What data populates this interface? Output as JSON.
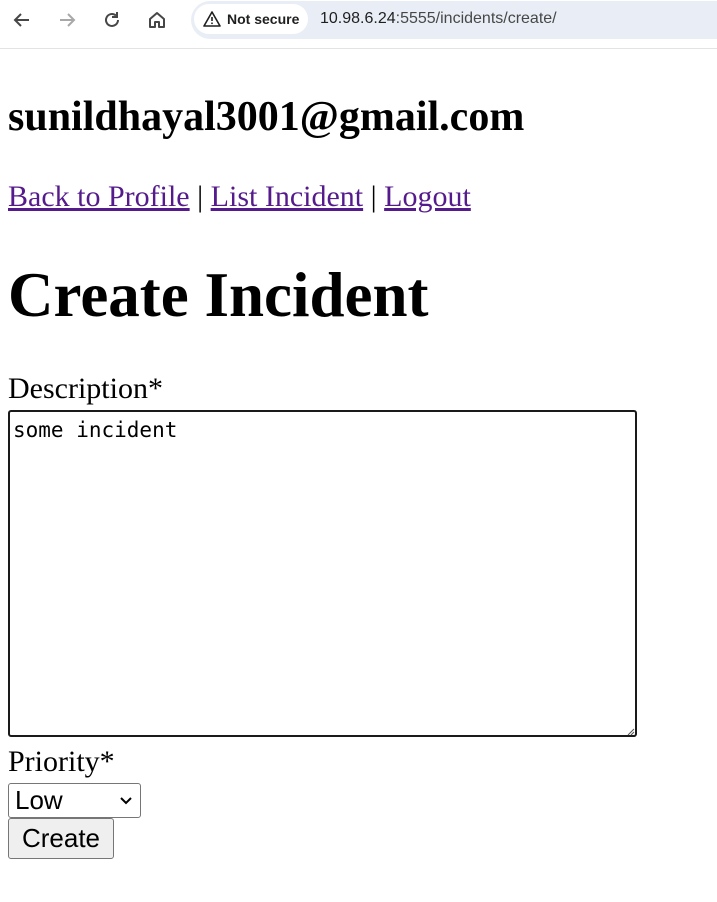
{
  "browser": {
    "security_label": "Not secure",
    "url_host": "10.98.6.24",
    "url_path": ":5555/incidents/create/"
  },
  "page": {
    "user_email": "sunildhayal3001@gmail.com",
    "nav": {
      "back_to_profile": "Back to Profile",
      "separator": "|",
      "list_incident": "List Incident",
      "logout": "Logout"
    },
    "title": "Create Incident",
    "form": {
      "description_label": "Description*",
      "description_value": "some incident",
      "priority_label": "Priority*",
      "priority_selected": "Low",
      "submit_label": "Create"
    }
  },
  "colors": {
    "link_visited": "#551a8b",
    "url_bar_bg": "#e9eef6"
  }
}
